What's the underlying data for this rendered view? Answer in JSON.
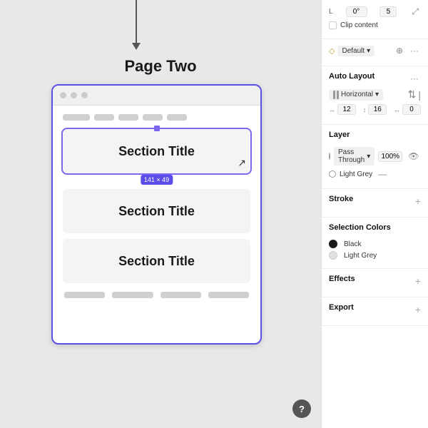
{
  "canvas": {
    "page_label": "Page Two",
    "arrow": "↓",
    "browser": {
      "dots": [
        "dot1",
        "dot2",
        "dot3"
      ],
      "sections": [
        {
          "id": 1,
          "title": "Section Title",
          "selected": true,
          "dimensions": "141 × 49"
        },
        {
          "id": 2,
          "title": "Section Title",
          "selected": false,
          "dimensions": null
        },
        {
          "id": 3,
          "title": "Section Title",
          "selected": false,
          "dimensions": null
        }
      ]
    }
  },
  "panel": {
    "rotation_label": "L",
    "rotation_value": "0°",
    "clip_value": "5",
    "clip_content_label": "Clip content",
    "default_label": "Default",
    "auto_layout_title": "Auto Layout",
    "layout_direction": "Horizontal",
    "gap_value1": "12",
    "gap_value2": "16",
    "gap_value3": "0",
    "layer_title": "Layer",
    "layer_mode": "Pass Through",
    "layer_opacity": "100%",
    "layer_color_label": "Light Grey",
    "stroke_title": "Stroke",
    "selection_colors_title": "Selection Colors",
    "color1_label": "Black",
    "color2_label": "Light Grey",
    "effects_title": "Effects",
    "export_title": "Export"
  }
}
